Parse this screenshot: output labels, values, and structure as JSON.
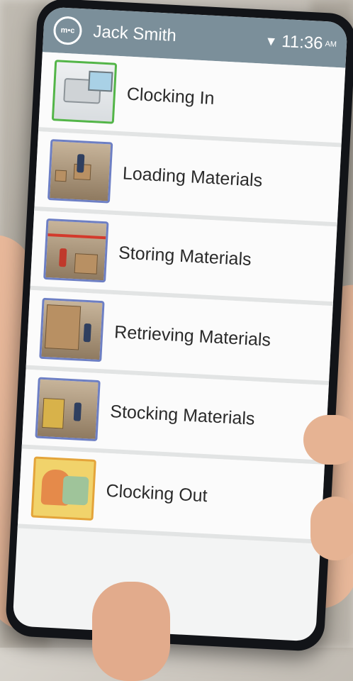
{
  "status_bar": {
    "app_icon_label": "m•c",
    "user_name": "Jack Smith",
    "time": "11:36",
    "ampm": "AM",
    "wifi_icon": "wifi-icon"
  },
  "menu": {
    "items": [
      {
        "label": "Clocking In",
        "icon": "clocking-in-thumbnail",
        "border": "#53b548"
      },
      {
        "label": "Loading Materials",
        "icon": "loading-materials-thumbnail",
        "border": "#6d7fc4"
      },
      {
        "label": "Storing Materials",
        "icon": "storing-materials-thumbnail",
        "border": "#6d7fc4"
      },
      {
        "label": "Retrieving Materials",
        "icon": "retrieving-materials-thumbnail",
        "border": "#6d7fc4"
      },
      {
        "label": "Stocking Materials",
        "icon": "stocking-materials-thumbnail",
        "border": "#6d7fc4"
      },
      {
        "label": "Clocking Out",
        "icon": "clocking-out-thumbnail",
        "border": "#e4a43a"
      }
    ]
  },
  "colors": {
    "status_bar_bg": "#7b8f9a",
    "screen_bg": "#f3f4f4"
  }
}
